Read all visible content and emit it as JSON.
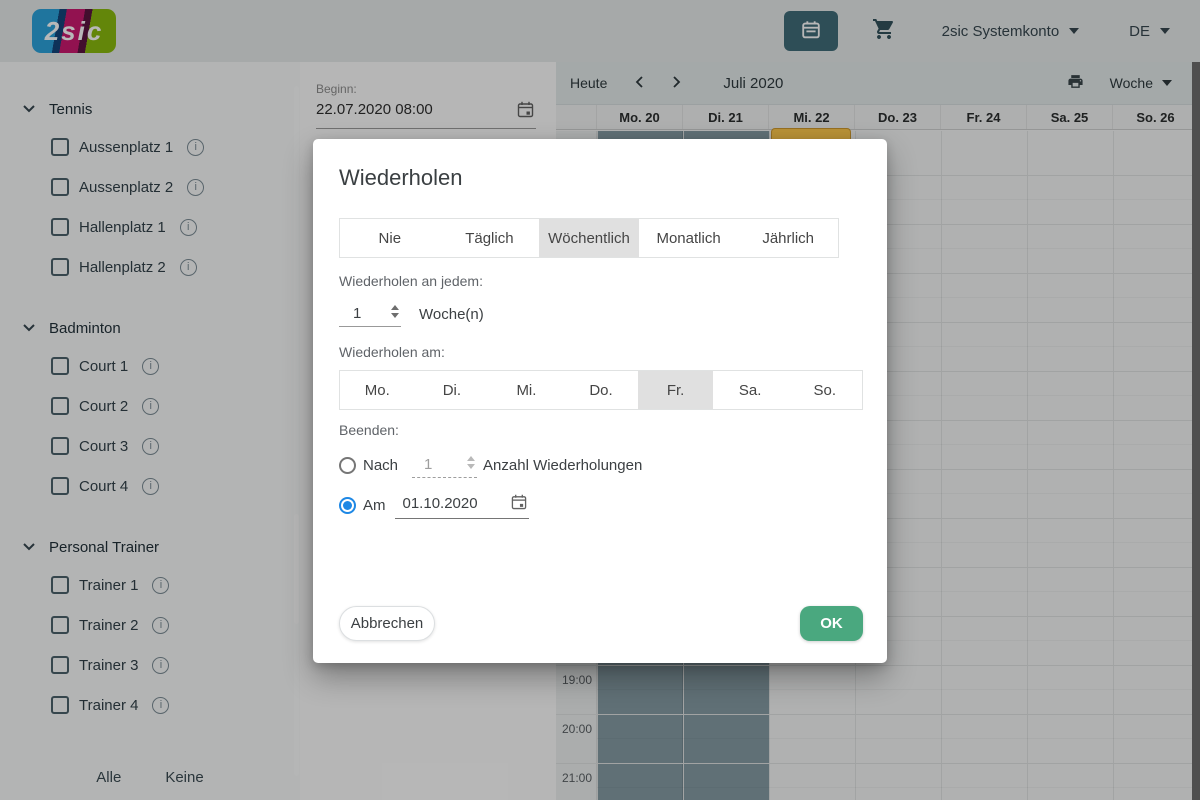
{
  "topbar": {
    "logo": "2sic",
    "account_label": "2sic Systemkonto",
    "language_label": "DE"
  },
  "sidebar": {
    "sections": [
      {
        "label": "Tennis",
        "items": [
          "Aussenplatz 1",
          "Aussenplatz 2",
          "Hallenplatz 1",
          "Hallenplatz 2"
        ]
      },
      {
        "label": "Badminton",
        "items": [
          "Court 1",
          "Court 2",
          "Court 3",
          "Court 4"
        ]
      },
      {
        "label": "Personal Trainer",
        "items": [
          "Trainer 1",
          "Trainer 2",
          "Trainer 3",
          "Trainer 4"
        ]
      }
    ],
    "footer": {
      "all_label": "Alle",
      "none_label": "Keine"
    }
  },
  "beginn": {
    "label": "Beginn:",
    "value": "22.07.2020 08:00"
  },
  "calendar": {
    "toolbar": {
      "today_label": "Heute",
      "title": "Juli 2020",
      "view_label": "Woche"
    },
    "day_headers": [
      "Mo. 20",
      "Di. 21",
      "Mi. 22",
      "Do. 23",
      "Fr. 24",
      "Sa. 25",
      "So. 26"
    ],
    "visible_time_labels": [
      "19:00",
      "20:00",
      "21:00"
    ],
    "event": {
      "day": "Mi. 22",
      "label": "",
      "color": "#ffc94d"
    }
  },
  "dialog": {
    "title": "Wiederholen",
    "frequency_tabs": [
      "Nie",
      "Täglich",
      "Wöchentlich",
      "Monatlich",
      "Jährlich"
    ],
    "active_tab": "Wöchentlich",
    "interval": {
      "label": "Wiederholen an jedem:",
      "value": "1",
      "unit": "Woche(n)"
    },
    "weekdays": {
      "label": "Wiederholen am:",
      "days": [
        "Mo.",
        "Di.",
        "Mi.",
        "Do.",
        "Fr.",
        "Sa.",
        "So."
      ],
      "selected": "Fr."
    },
    "end": {
      "label": "Beenden:",
      "after_option": {
        "label": "Nach",
        "value": "1",
        "suffix": "Anzahl Wiederholungen",
        "selected": false
      },
      "on_option": {
        "label": "Am",
        "value": "01.10.2020",
        "selected": true
      }
    },
    "cancel_label": "Abbrechen",
    "ok_label": "OK"
  },
  "colors": {
    "accent_green": "#4aa87f",
    "radio_blue": "#1e88e5",
    "selected_gray": "#e0e0e0",
    "event_orange": "#ffc94d",
    "dark_column": "#859ba4",
    "teal_button": "#406d79"
  }
}
